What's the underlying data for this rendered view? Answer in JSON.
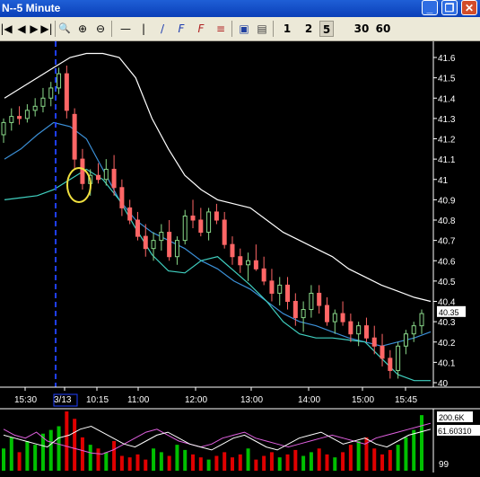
{
  "window": {
    "title": "N--5 Minute",
    "minimize_glyph": "_",
    "restore_glyph": "❐",
    "close_glyph": "✕"
  },
  "toolbar": {
    "buttons": [
      {
        "name": "first-icon",
        "glyph": "|◀"
      },
      {
        "name": "prev-icon",
        "glyph": "◀"
      },
      {
        "name": "next-icon",
        "glyph": "▶"
      },
      {
        "name": "last-icon",
        "glyph": "▶|"
      },
      {
        "name": "zoom-icon",
        "glyph": "🔍"
      },
      {
        "name": "zoom-in-icon",
        "glyph": "⊕"
      },
      {
        "name": "zoom-out-icon",
        "glyph": "⊖"
      },
      {
        "name": "hline-icon",
        "glyph": "—"
      },
      {
        "name": "vline-icon",
        "glyph": "|"
      },
      {
        "name": "trendline-icon",
        "glyph": "/"
      },
      {
        "name": "fib-icon",
        "glyph": "F"
      },
      {
        "name": "fib-ext-icon",
        "glyph": "F"
      },
      {
        "name": "lines-icon",
        "glyph": "≡"
      },
      {
        "name": "book-icon",
        "glyph": "▣"
      },
      {
        "name": "print-icon",
        "glyph": "▤"
      }
    ],
    "periods": [
      "1",
      "2",
      "5",
      "30",
      "60"
    ]
  },
  "colors": {
    "up": "#8ad98a",
    "down": "#ff6666",
    "band_upper": "#ffffff",
    "band_lower": "#40d0c0",
    "mid": "#3b8fd6",
    "vol_up": "#00c000",
    "vol_down": "#e00000",
    "osc1": "#e060e0",
    "osc2": "#ffffff",
    "marker": "#1f3fff",
    "circle": "#f0e040"
  },
  "price_axis": {
    "ticks": [
      "41.6",
      "41.5",
      "41.4",
      "41.3",
      "41.2",
      "41.1",
      "41",
      "40.9",
      "40.8",
      "40.7",
      "40.6",
      "40.5",
      "40.4",
      "40.3",
      "40.2",
      "40.1",
      "40"
    ],
    "last_price": "40.35"
  },
  "time_axis": {
    "labels": [
      "15:30",
      "3/13",
      "10:15",
      "11:00",
      "12:00",
      "13:00",
      "14:00",
      "15:00",
      "15:45"
    ]
  },
  "volume_panel": {
    "label1": "200.6K",
    "label2": "61.60310",
    "label3": "99"
  },
  "chart_data": {
    "type": "candlestick",
    "ylim": [
      40,
      41.6
    ],
    "candles": [
      [
        41.22,
        41.3,
        41.18,
        41.28
      ],
      [
        41.28,
        41.35,
        41.24,
        41.31
      ],
      [
        41.31,
        41.36,
        41.27,
        41.3
      ],
      [
        41.3,
        41.37,
        41.28,
        41.34
      ],
      [
        41.34,
        41.4,
        41.31,
        41.36
      ],
      [
        41.36,
        41.45,
        41.33,
        41.4
      ],
      [
        41.4,
        41.48,
        41.36,
        41.45
      ],
      [
        41.45,
        41.55,
        41.42,
        41.52
      ],
      [
        41.52,
        41.56,
        41.3,
        41.34
      ],
      [
        41.32,
        41.35,
        41.05,
        41.1
      ],
      [
        41.1,
        41.15,
        40.95,
        40.98
      ],
      [
        40.98,
        41.05,
        40.92,
        41.02
      ],
      [
        41.02,
        41.08,
        40.98,
        41.0
      ],
      [
        41.0,
        41.1,
        40.97,
        41.05
      ],
      [
        41.05,
        41.12,
        40.92,
        40.96
      ],
      [
        40.96,
        41.0,
        40.82,
        40.86
      ],
      [
        40.86,
        40.9,
        40.78,
        40.8
      ],
      [
        40.8,
        40.84,
        40.7,
        40.72
      ],
      [
        40.72,
        40.78,
        40.62,
        40.66
      ],
      [
        40.66,
        40.74,
        40.6,
        40.7
      ],
      [
        40.7,
        40.78,
        40.65,
        40.74
      ],
      [
        40.74,
        40.8,
        40.6,
        40.62
      ],
      [
        40.62,
        40.72,
        40.58,
        40.7
      ],
      [
        40.7,
        40.85,
        40.68,
        40.82
      ],
      [
        40.82,
        40.9,
        40.76,
        40.8
      ],
      [
        40.8,
        40.86,
        40.72,
        40.74
      ],
      [
        40.74,
        40.86,
        40.7,
        40.84
      ],
      [
        40.84,
        40.88,
        40.78,
        40.8
      ],
      [
        40.8,
        40.84,
        40.66,
        40.68
      ],
      [
        40.68,
        40.72,
        40.58,
        40.62
      ],
      [
        40.62,
        40.66,
        40.54,
        40.58
      ],
      [
        40.58,
        40.64,
        40.5,
        40.6
      ],
      [
        40.6,
        40.68,
        40.55,
        40.56
      ],
      [
        40.56,
        40.62,
        40.48,
        40.5
      ],
      [
        40.5,
        40.56,
        40.4,
        40.44
      ],
      [
        40.44,
        40.52,
        40.38,
        40.48
      ],
      [
        40.48,
        40.52,
        40.36,
        40.4
      ],
      [
        40.4,
        40.44,
        40.28,
        40.32
      ],
      [
        40.32,
        40.4,
        40.25,
        40.36
      ],
      [
        40.36,
        40.48,
        40.32,
        40.44
      ],
      [
        40.44,
        40.48,
        40.34,
        40.38
      ],
      [
        40.38,
        40.42,
        40.28,
        40.3
      ],
      [
        40.3,
        40.36,
        40.24,
        40.34
      ],
      [
        40.34,
        40.4,
        40.28,
        40.3
      ],
      [
        40.3,
        40.34,
        40.2,
        40.24
      ],
      [
        40.24,
        40.3,
        40.18,
        40.28
      ],
      [
        40.28,
        40.32,
        40.2,
        40.22
      ],
      [
        40.22,
        40.28,
        40.14,
        40.18
      ],
      [
        40.18,
        40.24,
        40.08,
        40.12
      ],
      [
        40.12,
        40.16,
        40.02,
        40.06
      ],
      [
        40.06,
        40.2,
        40.02,
        40.18
      ],
      [
        40.18,
        40.26,
        40.14,
        40.24
      ],
      [
        40.24,
        40.3,
        40.2,
        40.28
      ],
      [
        40.28,
        40.36,
        40.24,
        40.34
      ]
    ],
    "upper_band": [
      41.4,
      41.45,
      41.5,
      41.55,
      41.6,
      41.62,
      41.62,
      41.6,
      41.5,
      41.3,
      41.15,
      41.02,
      40.95,
      40.9,
      40.88,
      40.86,
      40.8,
      40.74,
      40.7,
      40.66,
      40.62,
      40.56,
      40.52,
      40.48,
      40.45,
      40.42,
      40.4
    ],
    "lower_band": [
      40.9,
      40.91,
      40.92,
      40.95,
      41.0,
      41.05,
      41.0,
      40.9,
      40.76,
      40.63,
      40.55,
      40.54,
      40.6,
      40.62,
      40.55,
      40.48,
      40.4,
      40.3,
      40.24,
      40.22,
      40.22,
      40.21,
      40.2,
      40.12,
      40.04,
      40.01,
      40.01
    ],
    "middle": [
      41.1,
      41.15,
      41.22,
      41.28,
      41.26,
      41.2,
      41.05,
      40.9,
      40.8,
      40.74,
      40.7,
      40.66,
      40.6,
      40.56,
      40.5,
      40.46,
      40.4,
      40.34,
      40.3,
      40.28,
      40.25,
      40.22,
      40.2,
      40.18,
      40.2,
      40.22,
      40.25
    ],
    "volume": [
      30,
      45,
      25,
      40,
      35,
      50,
      55,
      60,
      80,
      70,
      45,
      35,
      30,
      25,
      40,
      20,
      18,
      22,
      15,
      30,
      25,
      20,
      35,
      28,
      22,
      18,
      15,
      20,
      25,
      18,
      22,
      30,
      15,
      20,
      25,
      18,
      22,
      28,
      20,
      25,
      30,
      22,
      18,
      25,
      35,
      40,
      45,
      30,
      22,
      28,
      35,
      45,
      55,
      75
    ],
    "osc1": [
      70,
      60,
      55,
      65,
      50,
      45,
      40,
      35,
      30,
      28,
      35,
      45,
      55,
      65,
      70,
      60,
      50,
      45,
      40,
      45,
      55,
      60,
      65,
      55,
      50,
      45,
      40,
      45,
      50,
      55,
      60,
      55,
      50,
      45,
      55,
      60,
      65,
      70,
      75,
      80
    ],
    "osc2": [
      60,
      55,
      50,
      45,
      40,
      55,
      60,
      70,
      75,
      65,
      55,
      45,
      40,
      50,
      60,
      65,
      55,
      45,
      40,
      35,
      45,
      55,
      60,
      50,
      40,
      35,
      45,
      55,
      60,
      65,
      55,
      45,
      50,
      55,
      45,
      40,
      50,
      60,
      65,
      70
    ]
  }
}
